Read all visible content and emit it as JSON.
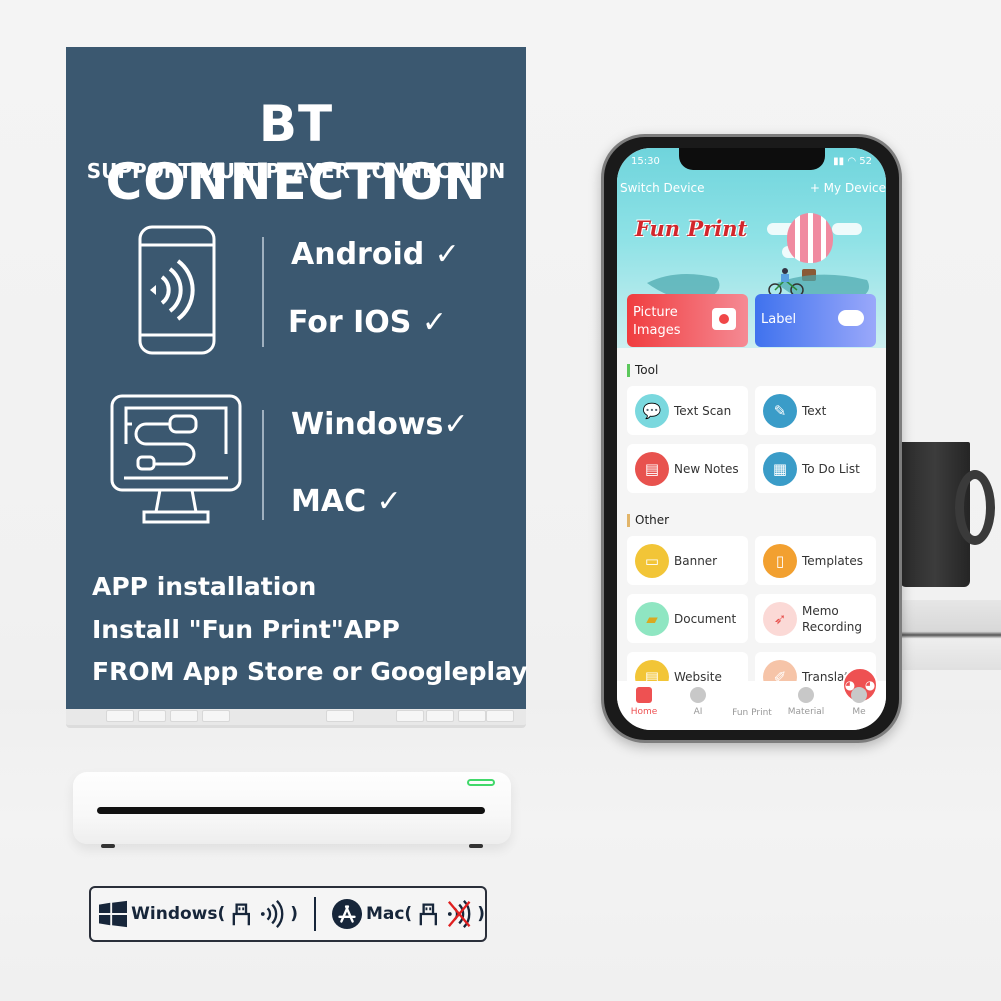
{
  "panel": {
    "title": "BT CONNECTION",
    "subtitle": "SUPPORT MULTIPLAYER CONNECTION",
    "mobile_platforms": [
      "Android ✓",
      "For IOS ✓"
    ],
    "desktop_platforms": [
      "Windows✓",
      "MAC ✓"
    ],
    "install_lines": [
      "APP installation",
      "Install \"Fun Print\"APP",
      "FROM App Store or Googleplay"
    ],
    "icons": {
      "mobile": "phone-wireless-icon",
      "desktop": "monitor-usb-icon"
    }
  },
  "compatibility": {
    "windows_label": "Windows(",
    "windows_close": ")",
    "mac_label": "Mac(",
    "mac_close": ")",
    "windows_support": {
      "usb": true,
      "bluetooth": true
    },
    "mac_support": {
      "usb": true,
      "bluetooth": false
    }
  },
  "phone": {
    "status": {
      "time": "15:30",
      "battery": "52"
    },
    "switch_device": "Switch Device",
    "my_device": "+ My Device",
    "brand": "Fun Print",
    "feature_cards": [
      {
        "label": "Picture Images",
        "color": "#f04748"
      },
      {
        "label": "Label",
        "color": "#4b7ff0"
      }
    ],
    "sections": [
      {
        "title": "Tool",
        "accent": "#5cc85c",
        "items": [
          {
            "label": "Text Scan",
            "icon": "chat-bubbles-icon",
            "color": "#7ad8de"
          },
          {
            "label": "Text",
            "icon": "pencil-icon",
            "color": "#3a9cc8"
          },
          {
            "label": "New Notes",
            "icon": "newspaper-icon",
            "color": "#e8524e"
          },
          {
            "label": "To Do List",
            "icon": "notepad-icon",
            "color": "#3a9cc8"
          }
        ]
      },
      {
        "title": "Other",
        "accent": "#e2b56a",
        "items": [
          {
            "label": "Banner",
            "icon": "billboard-icon",
            "color": "#f2c537"
          },
          {
            "label": "Templates",
            "icon": "badge-icon",
            "color": "#f2a030"
          },
          {
            "label": "Document",
            "icon": "folder-icon",
            "color": "#8fe6c2"
          },
          {
            "label": "Memo Recording",
            "icon": "rocket-icon",
            "color": "#fbd9d6"
          },
          {
            "label": "Website",
            "icon": "webpage-icon",
            "color": "#f2c537"
          },
          {
            "label": "Translate",
            "icon": "pen-icon",
            "color": "#f6c4a8"
          }
        ]
      }
    ],
    "tabs": [
      {
        "label": "Home",
        "active": true
      },
      {
        "label": "AI",
        "active": false
      },
      {
        "label": "Fun Print",
        "active": false
      },
      {
        "label": "Material",
        "active": false
      },
      {
        "label": "Me",
        "active": false
      }
    ],
    "accent": "#ee5152"
  }
}
